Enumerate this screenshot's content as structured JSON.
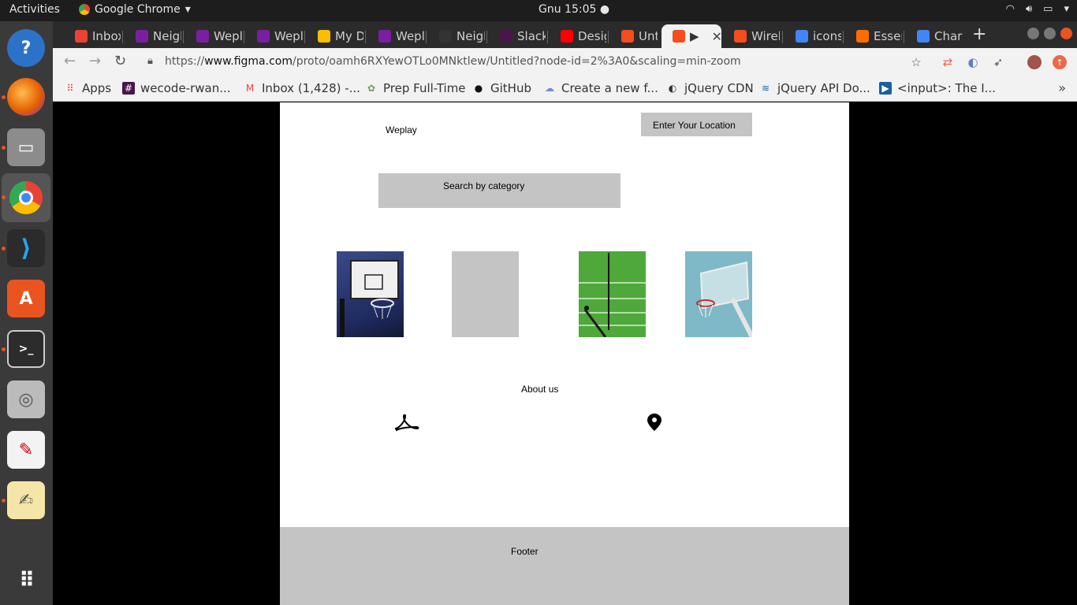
{
  "desktop": {
    "activities": "Activities",
    "app_name": "Google Chrome",
    "clock": "Gnu 15:05"
  },
  "dock": {
    "items": [
      "help-icon",
      "firefox-icon",
      "files-icon",
      "chrome-icon",
      "vscode-icon",
      "software-center-icon",
      "terminal-icon",
      "disk-utility-icon",
      "pdf-viewer-icon",
      "text-editor-icon",
      "app-grid-icon"
    ]
  },
  "tabs": [
    {
      "label": "Inbox",
      "color": "#ea4335"
    },
    {
      "label": "Neigl",
      "color": "#7b1fa2"
    },
    {
      "label": "Wepl",
      "color": "#7b1fa2"
    },
    {
      "label": "Wepl",
      "color": "#7b1fa2"
    },
    {
      "label": "My D",
      "color": "#fbbc04"
    },
    {
      "label": "Wepl",
      "color": "#7b1fa2"
    },
    {
      "label": "Neigl",
      "color": "#333333"
    },
    {
      "label": "Slack",
      "color": "#4a154b"
    },
    {
      "label": "Desig",
      "color": "#ff0000"
    },
    {
      "label": "Untit",
      "color": "#f24e1e"
    },
    {
      "label": "▶",
      "color": "#f24e1e"
    },
    {
      "label": "Wirel",
      "color": "#f24e1e"
    },
    {
      "label": "icons",
      "color": "#4285f4"
    },
    {
      "label": "Esser",
      "color": "#ff6d00"
    },
    {
      "label": "Charl",
      "color": "#4285f4"
    }
  ],
  "toolbar": {
    "url_prefix": "https://",
    "url_host": "www.figma.com",
    "url_path": "/proto/oamh6RXYewOTLo0MNktlew/Untitled?node-id=2%3A0&scaling=min-zoom"
  },
  "bookmarks": [
    {
      "label": "Apps"
    },
    {
      "label": "wecode-rwan..."
    },
    {
      "label": "Inbox (1,428) -..."
    },
    {
      "label": "Prep Full-Time"
    },
    {
      "label": "GitHub"
    },
    {
      "label": "Create a new f..."
    },
    {
      "label": "jQuery CDN"
    },
    {
      "label": "jQuery API Do..."
    },
    {
      "label": "<input>: The I..."
    }
  ],
  "prototype": {
    "brand": "Weplay",
    "location_button": "Enter Your Location",
    "search_box": "Search by category",
    "about": "About us",
    "footer": "Footer"
  }
}
